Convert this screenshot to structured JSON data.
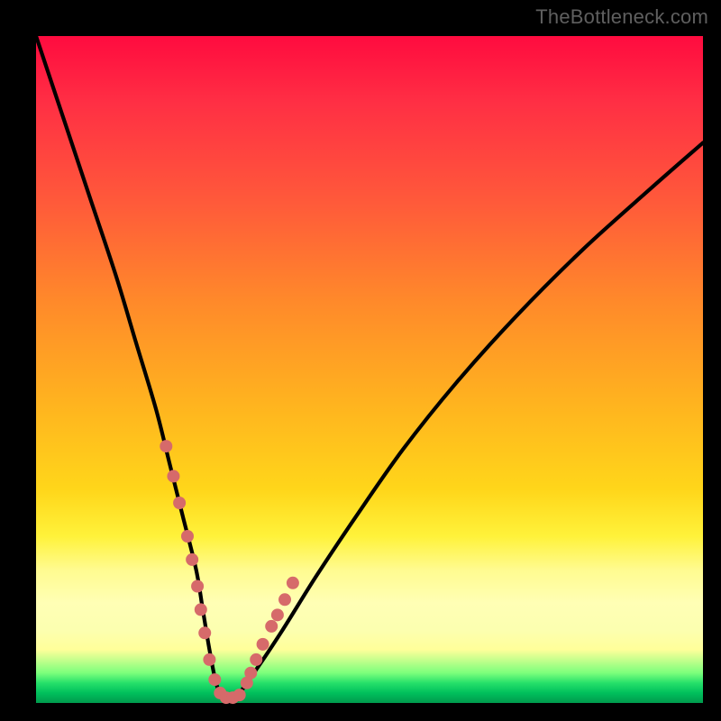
{
  "watermark": "TheBottleneck.com",
  "chart_data": {
    "type": "line",
    "title": "",
    "xlabel": "",
    "ylabel": "",
    "xlim": [
      0,
      100
    ],
    "ylim": [
      0,
      100
    ],
    "grid": false,
    "legend": false,
    "series": [
      {
        "name": "bottleneck-curve",
        "color": "#000000",
        "x": [
          0,
          4,
          8,
          12,
          15,
          18,
          20,
          22,
          24,
          25,
          26,
          27,
          28,
          30,
          33,
          37,
          42,
          48,
          55,
          63,
          72,
          82,
          92,
          100
        ],
        "y": [
          100,
          88,
          76,
          64,
          54,
          44,
          36,
          28,
          20,
          14,
          8,
          3,
          1,
          1,
          5,
          11,
          19,
          28,
          38,
          48,
          58,
          68,
          77,
          84
        ]
      }
    ],
    "markers": {
      "name": "highlight-dots",
      "color": "#d66a6a",
      "radius_px": 7,
      "x": [
        19.5,
        20.6,
        21.5,
        22.7,
        23.4,
        24.2,
        24.7,
        25.3,
        26.0,
        26.8,
        27.6,
        28.5,
        29.5,
        30.5,
        31.6,
        32.2,
        33.0,
        34.0,
        35.3,
        36.2,
        37.3,
        38.5
      ],
      "y": [
        38.5,
        34.0,
        30.0,
        25.0,
        21.5,
        17.5,
        14.0,
        10.5,
        6.5,
        3.5,
        1.5,
        0.8,
        0.8,
        1.2,
        3.0,
        4.5,
        6.5,
        8.8,
        11.5,
        13.2,
        15.5,
        18.0
      ]
    }
  }
}
